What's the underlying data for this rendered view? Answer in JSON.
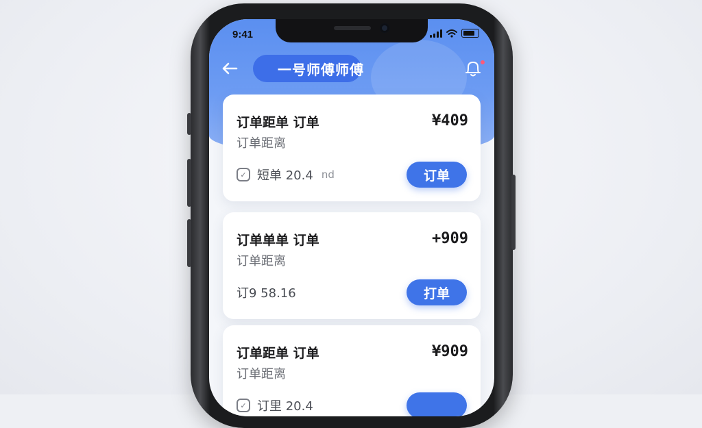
{
  "status_bar": {
    "time": "9:41"
  },
  "header": {
    "title": "一号师傅师傅"
  },
  "orders": [
    {
      "title": "订单距单 订单",
      "subtitle": "订单距离",
      "price": "¥409",
      "meta": "短单 20.4",
      "meta_suffix": "nd",
      "action": "订单"
    },
    {
      "title": "订单单单 订单",
      "subtitle": "订单距离",
      "price": "+909",
      "meta": "订9 58.16",
      "meta_suffix": "",
      "action": "打单"
    },
    {
      "title": "订单距单 订单",
      "subtitle": "订单距离",
      "price": "¥909",
      "meta": "订里 20.4",
      "meta_suffix": "",
      "action": ""
    }
  ],
  "colors": {
    "accent": "#3f74e8",
    "hero": "#5b8ff0",
    "notification_dot": "#ff5a7a"
  },
  "icons": {
    "back": "arrow-left-icon",
    "bell": "bell-icon",
    "meta": "leaf-icon"
  }
}
